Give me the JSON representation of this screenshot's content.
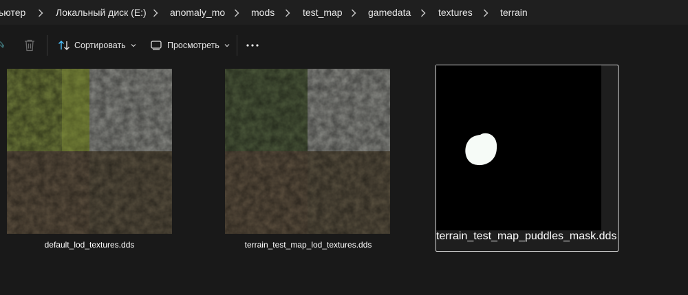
{
  "breadcrumb": {
    "items": [
      "ьютер",
      "Локальный диск (E:)",
      "anomaly_mo",
      "mods",
      "test_map",
      "gamedata",
      "textures",
      "terrain"
    ]
  },
  "toolbar": {
    "sort_label": "Сортировать",
    "view_label": "Просмотреть",
    "more_label": "•••"
  },
  "files": [
    {
      "name": "default_lod_textures.dds",
      "selected": false
    },
    {
      "name": "terrain_test_map_lod_textures.dds",
      "selected": false
    },
    {
      "name": "terrain_test_map_puddles_mask.dds",
      "selected": true
    }
  ],
  "colors": {
    "background": "#191919",
    "addressbar": "#1f1f1f",
    "selection_border": "#d7d7d7",
    "sort_icon_blue": "#4cc2ff"
  }
}
